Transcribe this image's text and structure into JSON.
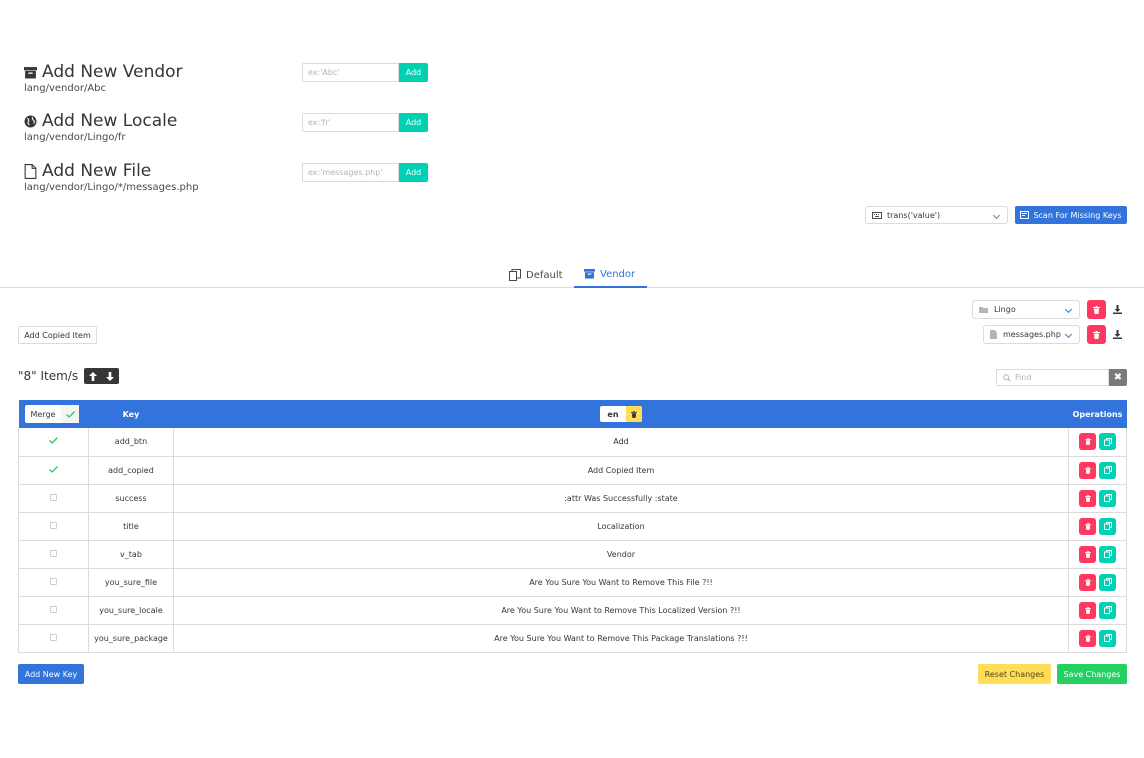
{
  "add_vendor": {
    "title": "Add New Vendor",
    "path": "lang/vendor/Abc",
    "placeholder": "ex:'Abc'",
    "button": "Add"
  },
  "add_locale": {
    "title": "Add New Locale",
    "path": "lang/vendor/Lingo/fr",
    "placeholder": "ex:'fr'",
    "button": "Add"
  },
  "add_file": {
    "title": "Add New File",
    "path": "lang/vendor/Lingo/*/messages.php",
    "placeholder": "ex:'messages.php'",
    "button": "Add"
  },
  "scan": {
    "method": "trans('value')",
    "button": "Scan For Missing Keys"
  },
  "tabs": [
    {
      "label": "Default"
    },
    {
      "label": "Vendor"
    }
  ],
  "vendor_select": "Lingo",
  "file_select": "messages.php",
  "add_copied_button": "Add Copied Item",
  "items_count": "\"8\" Item/s",
  "search": {
    "placeholder": "Find"
  },
  "table": {
    "merge_label": "Merge",
    "key_header": "Key",
    "locale": "en",
    "operations_header": "Operations",
    "rows": [
      {
        "checked": true,
        "key": "add_btn",
        "value": "Add"
      },
      {
        "checked": true,
        "key": "add_copied",
        "value": "Add Copied Item"
      },
      {
        "checked": false,
        "key": "success",
        "value": ":attr Was Successfully :state"
      },
      {
        "checked": false,
        "key": "title",
        "value": "Localization"
      },
      {
        "checked": false,
        "key": "v_tab",
        "value": "Vendor"
      },
      {
        "checked": false,
        "key": "you_sure_file",
        "value": "Are You Sure You Want to Remove This File ?!!"
      },
      {
        "checked": false,
        "key": "you_sure_locale",
        "value": "Are You Sure You Want to Remove This Localized Version ?!!"
      },
      {
        "checked": false,
        "key": "you_sure_package",
        "value": "Are You Sure You Want to Remove This Package Translations ?!!"
      }
    ]
  },
  "footer": {
    "add_key": "Add New Key",
    "reset": "Reset Changes",
    "save": "Save Changes"
  },
  "colors": {
    "primary": "#3273dc",
    "success": "#23d160",
    "danger": "#ff3860",
    "teal": "#00d1b2",
    "warning": "#ffdd57"
  }
}
